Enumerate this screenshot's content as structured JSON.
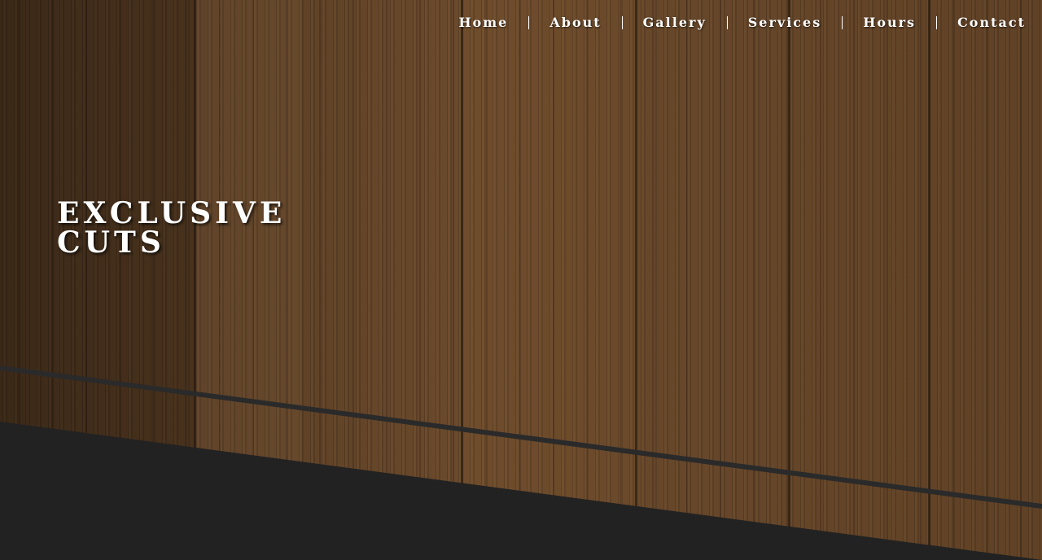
{
  "nav": {
    "items": [
      {
        "label": "Home"
      },
      {
        "label": "About"
      },
      {
        "label": "Gallery"
      },
      {
        "label": "Services"
      },
      {
        "label": "Hours"
      },
      {
        "label": "Contact"
      }
    ]
  },
  "hero": {
    "title_line1": "EXCLUSIVE",
    "title_line2": "CUTS"
  },
  "colors": {
    "wood_base": "#6b4a2c",
    "dark_band": "#222222",
    "text": "#ffffff"
  }
}
